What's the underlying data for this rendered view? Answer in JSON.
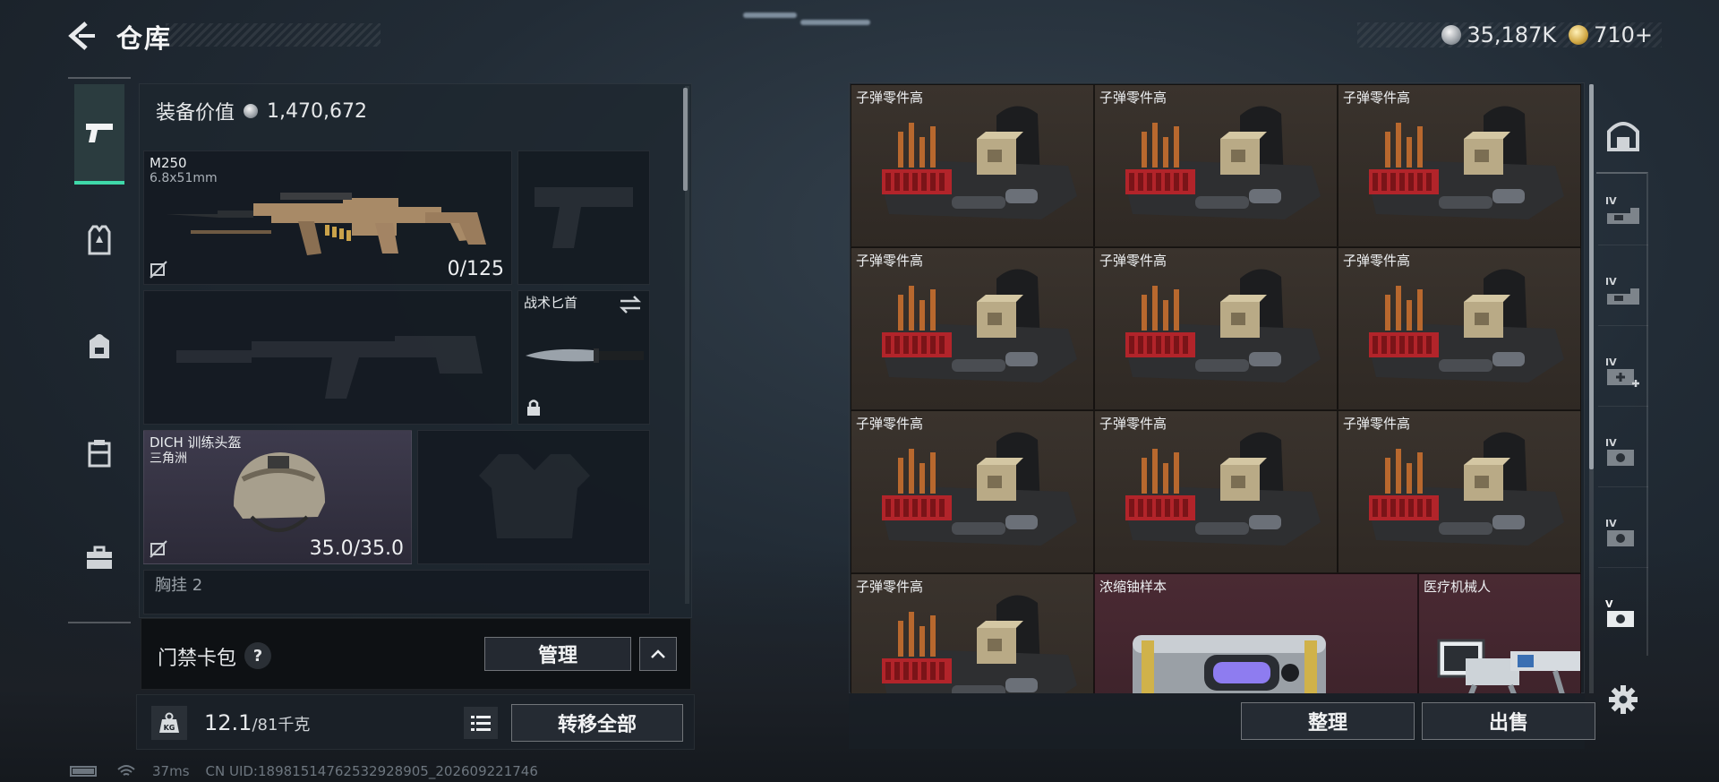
{
  "header": {
    "title": "仓库",
    "currencies": [
      {
        "icon": "silver-coin-icon",
        "value": "35,187K"
      },
      {
        "icon": "gold-coin-icon",
        "value": "710+"
      }
    ]
  },
  "left_rail": [
    {
      "icon": "pistol-icon",
      "active": true
    },
    {
      "icon": "armor-vest-icon",
      "active": false
    },
    {
      "icon": "backpack-icon",
      "active": false
    },
    {
      "icon": "chest-rig-icon",
      "active": false
    },
    {
      "icon": "briefcase-icon",
      "active": false
    }
  ],
  "loadout": {
    "equip_value_label": "装备价值",
    "equip_value": "1,470,672",
    "primary": {
      "name": "M250",
      "caliber": "6.8x51mm",
      "ammo": "0/125"
    },
    "knife": {
      "name": "战术匕首"
    },
    "helmet": {
      "name": "DICH 训练头盔",
      "sub": "三角洲",
      "durability": "35.0/35.0"
    },
    "chest_partial_label": "胸挂 2"
  },
  "keycard": {
    "label": "门禁卡包",
    "help": "?",
    "manage": "管理"
  },
  "weight": {
    "icon_label": "KG",
    "current": "12.1",
    "max": "/81千克",
    "transfer_all": "转移全部"
  },
  "inventory": {
    "items": [
      {
        "label": "子弹零件高",
        "kind": "ammo-parts"
      },
      {
        "label": "子弹零件高",
        "kind": "ammo-parts"
      },
      {
        "label": "子弹零件高",
        "kind": "ammo-parts"
      },
      {
        "label": "子弹零件高",
        "kind": "ammo-parts"
      },
      {
        "label": "子弹零件高",
        "kind": "ammo-parts"
      },
      {
        "label": "子弹零件高",
        "kind": "ammo-parts"
      },
      {
        "label": "子弹零件高",
        "kind": "ammo-parts"
      },
      {
        "label": "子弹零件高",
        "kind": "ammo-parts"
      },
      {
        "label": "子弹零件高",
        "kind": "ammo-parts"
      },
      {
        "label": "子弹零件高",
        "kind": "ammo-parts"
      },
      {
        "label": "浓缩铀样本",
        "kind": "uranium"
      },
      {
        "label": "医疗机械人",
        "kind": "robot"
      }
    ],
    "sort": "整理",
    "sell": "出售"
  },
  "right_rail": [
    {
      "icon": "vault-icon",
      "tag": ""
    },
    {
      "icon": "storage-tier-icon",
      "tag": "IV"
    },
    {
      "icon": "storage-tier-icon",
      "tag": "IV"
    },
    {
      "icon": "medical-storage-icon",
      "tag": "IV"
    },
    {
      "icon": "safe-storage-icon",
      "tag": "IV"
    },
    {
      "icon": "safe-storage-icon",
      "tag": "IV"
    },
    {
      "icon": "safe-storage-icon",
      "tag": "V"
    },
    {
      "icon": "gear-icon",
      "tag": ""
    }
  ],
  "status": {
    "ping": "37ms",
    "uid": "CN UID:18981514762532928905_202609221746"
  },
  "colors": {
    "accent": "#3fd9a9",
    "ammo_cell": "#3a332d",
    "rare_cell": "#4a2a33"
  }
}
